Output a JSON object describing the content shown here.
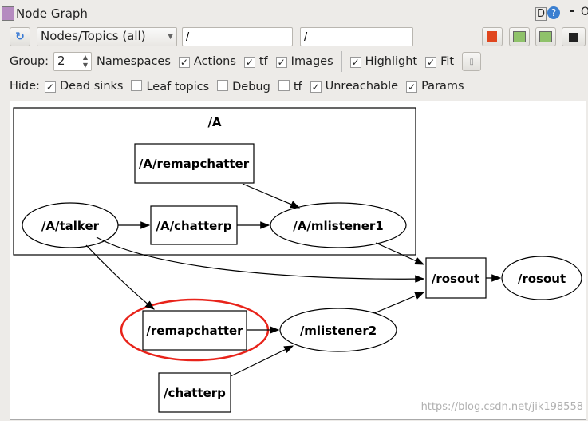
{
  "window": {
    "title": "Node Graph",
    "d_label": "D",
    "help_icon": "help-icon",
    "minimize": "-",
    "close": "O"
  },
  "toolbar": {
    "refresh_icon": "refresh-icon",
    "graph_type": "Nodes/Topics (all)",
    "node_filter": "/",
    "topic_filter": "/",
    "icons": [
      "load-icon",
      "save-dot-icon",
      "save-svg-icon",
      "screenshot-icon"
    ]
  },
  "options": {
    "group_label": "Group:",
    "group_value": "2",
    "namespaces": "Namespaces",
    "checks": [
      {
        "label": "Actions",
        "checked": true
      },
      {
        "label": "tf",
        "checked": true
      },
      {
        "label": "Images",
        "checked": true
      },
      {
        "label": "Highlight",
        "checked": true
      },
      {
        "label": "Fit",
        "checked": true
      }
    ]
  },
  "hide": {
    "label": "Hide:",
    "checks": [
      {
        "label": "Dead sinks",
        "checked": true
      },
      {
        "label": "Leaf topics",
        "checked": false
      },
      {
        "label": "Debug",
        "checked": false
      },
      {
        "label": "tf",
        "checked": false
      },
      {
        "label": "Unreachable",
        "checked": true
      },
      {
        "label": "Params",
        "checked": true
      }
    ]
  },
  "graph": {
    "cluster": "/A",
    "nodes": {
      "a_remapchatter": "/A/remapchatter",
      "a_talker": "/A/talker",
      "a_chatterp": "/A/chatterp",
      "a_mlistener1": "/A/mlistener1",
      "rosout_topic": "/rosout",
      "rosout_node": "/rosout",
      "remapchatter": "/remapchatter",
      "mlistener2": "/mlistener2",
      "chatterp": "/chatterp"
    },
    "highlight_color": "#e8231a",
    "watermark": "https://blog.csdn.net/jik198558"
  }
}
